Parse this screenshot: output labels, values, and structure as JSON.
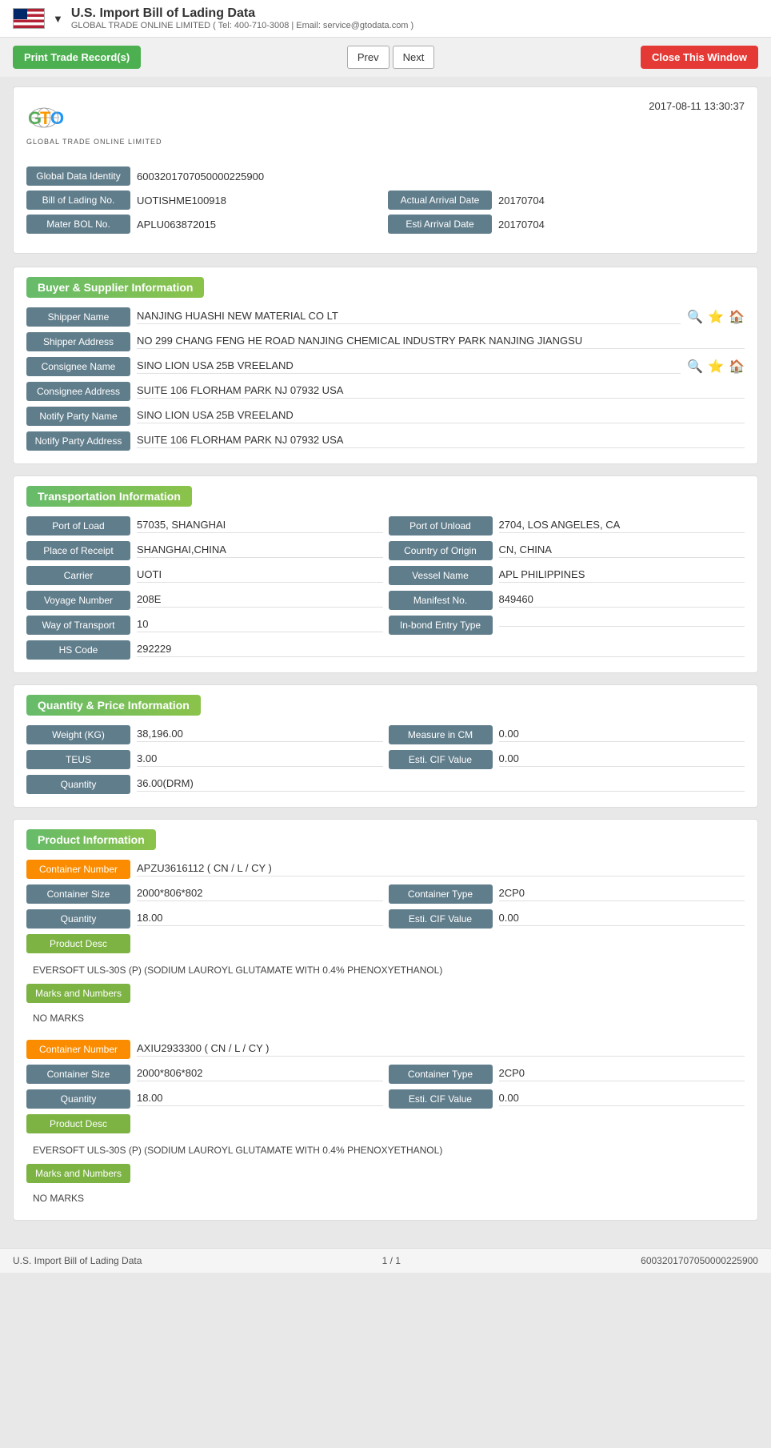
{
  "topBar": {
    "title": "U.S. Import Bill of Lading Data",
    "subtitle": "GLOBAL TRADE ONLINE LIMITED ( Tel: 400-710-3008 | Email: service@gtodata.com )",
    "dropdownArrow": "▼"
  },
  "actionBar": {
    "printLabel": "Print Trade Record(s)",
    "prevLabel": "Prev",
    "nextLabel": "Next",
    "closeLabel": "Close This Window"
  },
  "docHeader": {
    "logoSubtitle": "GLOBAL TRADE ONLINE LIMITED",
    "timestamp": "2017-08-11 13:30:37"
  },
  "identity": {
    "globalDataLabel": "Global Data Identity",
    "globalDataValue": "6003201707050000225900",
    "bolLabel": "Bill of Lading No.",
    "bolValue": "UOTISHME100918",
    "actualArrivalLabel": "Actual Arrival Date",
    "actualArrivalValue": "20170704",
    "materBolLabel": "Mater BOL No.",
    "materBolValue": "APLU063872015",
    "estiArrivalLabel": "Esti Arrival Date",
    "estiArrivalValue": "20170704"
  },
  "buyerSupplier": {
    "sectionTitle": "Buyer & Supplier Information",
    "shipperNameLabel": "Shipper Name",
    "shipperNameValue": "NANJING HUASHI NEW MATERIAL CO LT",
    "shipperAddressLabel": "Shipper Address",
    "shipperAddressValue": "NO 299 CHANG FENG HE ROAD NANJING CHEMICAL INDUSTRY PARK NANJING JIANGSU",
    "consigneeNameLabel": "Consignee Name",
    "consigneeNameValue": "SINO LION USA 25B VREELAND",
    "consigneeAddressLabel": "Consignee Address",
    "consigneeAddressValue": "SUITE 106 FLORHAM PARK NJ 07932 USA",
    "notifyPartyNameLabel": "Notify Party Name",
    "notifyPartyNameValue": "SINO LION USA 25B VREELAND",
    "notifyPartyAddressLabel": "Notify Party Address",
    "notifyPartyAddressValue": "SUITE 106 FLORHAM PARK NJ 07932 USA"
  },
  "transportation": {
    "sectionTitle": "Transportation Information",
    "portOfLoadLabel": "Port of Load",
    "portOfLoadValue": "57035, SHANGHAI",
    "portOfUnloadLabel": "Port of Unload",
    "portOfUnloadValue": "2704, LOS ANGELES, CA",
    "placeOfReceiptLabel": "Place of Receipt",
    "placeOfReceiptValue": "SHANGHAI,CHINA",
    "countryOfOriginLabel": "Country of Origin",
    "countryOfOriginValue": "CN, CHINA",
    "carrierLabel": "Carrier",
    "carrierValue": "UOTI",
    "vesselNameLabel": "Vessel Name",
    "vesselNameValue": "APL PHILIPPINES",
    "voyageNumberLabel": "Voyage Number",
    "voyageNumberValue": "208E",
    "manifestNoLabel": "Manifest No.",
    "manifestNoValue": "849460",
    "wayOfTransportLabel": "Way of Transport",
    "wayOfTransportValue": "10",
    "inbondEntryTypeLabel": "In-bond Entry Type",
    "inbondEntryTypeValue": "",
    "hsCodeLabel": "HS Code",
    "hsCodeValue": "292229"
  },
  "quantityPrice": {
    "sectionTitle": "Quantity & Price Information",
    "weightLabel": "Weight (KG)",
    "weightValue": "38,196.00",
    "measureLabel": "Measure in CM",
    "measureValue": "0.00",
    "teusLabel": "TEUS",
    "teusValue": "3.00",
    "estiCifLabel": "Esti. CIF Value",
    "estiCifValue": "0.00",
    "quantityLabel": "Quantity",
    "quantityValue": "36.00(DRM)"
  },
  "productInfo": {
    "sectionTitle": "Product Information",
    "containers": [
      {
        "containerNumberLabel": "Container Number",
        "containerNumberValue": "APZU3616112 ( CN / L / CY )",
        "containerSizeLabel": "Container Size",
        "containerSizeValue": "2000*806*802",
        "containerTypeLabel": "Container Type",
        "containerTypeValue": "2CP0",
        "quantityLabel": "Quantity",
        "quantityValue": "18.00",
        "estiCifLabel": "Esti. CIF Value",
        "estiCifValue": "0.00",
        "productDescLabel": "Product Desc",
        "productDescValue": "EVERSOFT ULS-30S (P) (SODIUM LAUROYL GLUTAMATE WITH 0.4% PHENOXYETHANOL)",
        "marksLabel": "Marks and Numbers",
        "marksValue": "NO MARKS"
      },
      {
        "containerNumberLabel": "Container Number",
        "containerNumberValue": "AXIU2933300 ( CN / L / CY )",
        "containerSizeLabel": "Container Size",
        "containerSizeValue": "2000*806*802",
        "containerTypeLabel": "Container Type",
        "containerTypeValue": "2CP0",
        "quantityLabel": "Quantity",
        "quantityValue": "18.00",
        "estiCifLabel": "Esti. CIF Value",
        "estiCifValue": "0.00",
        "productDescLabel": "Product Desc",
        "productDescValue": "EVERSOFT ULS-30S (P) (SODIUM LAUROYL GLUTAMATE WITH 0.4% PHENOXYETHANOL)",
        "marksLabel": "Marks and Numbers",
        "marksValue": "NO MARKS"
      }
    ]
  },
  "footer": {
    "leftText": "U.S. Import Bill of Lading Data",
    "pagination": "1 / 1",
    "rightText": "6003201707050000225900"
  }
}
